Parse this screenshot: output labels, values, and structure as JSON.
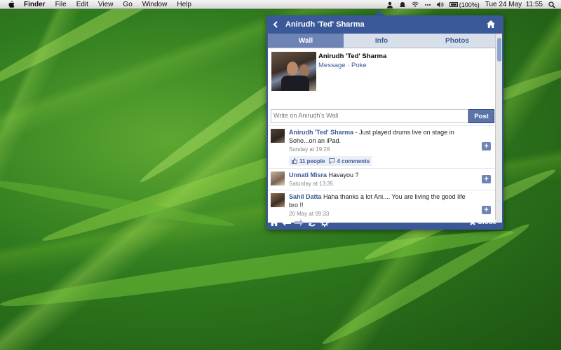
{
  "menubar": {
    "app_name": "Finder",
    "menus": [
      "File",
      "Edit",
      "View",
      "Go",
      "Window",
      "Help"
    ],
    "battery_text": "(100%)",
    "clock": "Tue 24 May  11:55"
  },
  "widget": {
    "title": "Anirudh 'Ted' Sharma",
    "tabs": [
      {
        "label": "Wall",
        "active": true
      },
      {
        "label": "Info",
        "active": false
      },
      {
        "label": "Photos",
        "active": false
      }
    ],
    "profile": {
      "name": "Anirudh 'Ted' Sharma",
      "links": "Message · Poke"
    },
    "composer": {
      "placeholder": "Write on Anirudh's Wall",
      "post_label": "Post"
    },
    "posts": [
      {
        "author": "Anirudh 'Ted' Sharma",
        "text": " - Just played drums live on stage in Soho...on an iPad.",
        "time": "Sunday at 19:28",
        "likes": "11 people",
        "comments": "4 comments"
      },
      {
        "author": "Unnati Misra",
        "text": " Havayou ?",
        "time": "Saturday at 13:35"
      },
      {
        "author": "Sahil Datta",
        "text": " Haha thanks a lot Ani.... You are living the good life bro !!",
        "time": "20 May at 09:33"
      }
    ],
    "close_label": "Close"
  },
  "colors": {
    "facebook_blue": "#3b5998",
    "tab_active": "#6d84b4"
  }
}
